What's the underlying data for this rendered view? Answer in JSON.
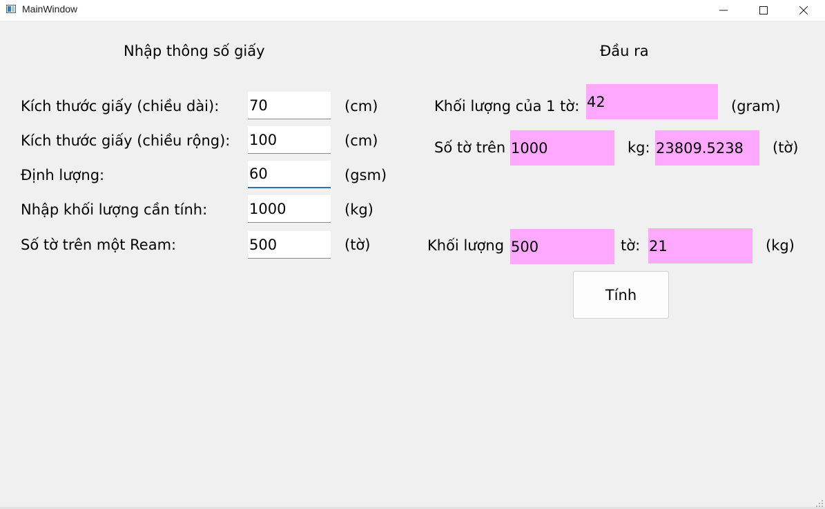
{
  "window": {
    "title": "MainWindow",
    "icons": {
      "app": "app-window-icon",
      "minimize": "minimize-icon",
      "maximize": "maximize-icon",
      "close": "close-icon"
    }
  },
  "input_section": {
    "heading": "Nhập thông số giấy",
    "rows": [
      {
        "label": "Kích thước giấy (chiều dài):",
        "value": "70",
        "unit": "(cm)"
      },
      {
        "label": "Kích thước giấy (chiều rộng):",
        "value": "100",
        "unit": "(cm)"
      },
      {
        "label": "Định lượng:",
        "value": "60",
        "unit": "(gsm)"
      },
      {
        "label": "Nhập khối lượng cần tính:",
        "value": "1000",
        "unit": "(kg)"
      },
      {
        "label": "Số tờ trên một Ream:",
        "value": "500",
        "unit": "(tờ)"
      }
    ]
  },
  "output_section": {
    "heading": "Đầu ra",
    "sheet_weight": {
      "label": "Khối lượng của 1 tờ:",
      "value": "42",
      "unit": "(gram)"
    },
    "sheets_per_kg": {
      "label": "Số tờ trên",
      "kg_value": "1000",
      "kg_label": "kg:",
      "value": "23809.5238",
      "unit": "(tờ)"
    },
    "weight_of_sheets": {
      "label": "Khối lượng",
      "sheets_value": "500",
      "sheets_label": "tờ:",
      "value": "21",
      "unit": "(kg)"
    },
    "output_color": "#ffa8ff"
  },
  "actions": {
    "compute_label": "Tính"
  }
}
